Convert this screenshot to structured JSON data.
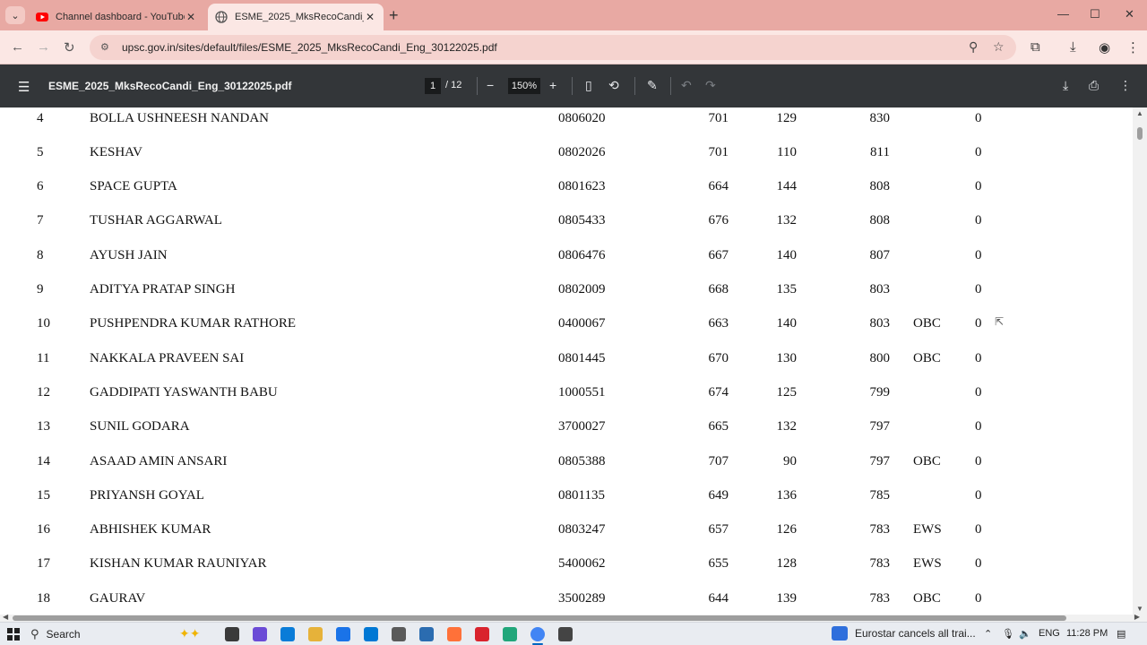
{
  "browser": {
    "tabs": [
      {
        "title": "Channel dashboard - YouTube Studio",
        "active": false,
        "favicon": "youtube-icon",
        "favicon_color": "#ff0000"
      },
      {
        "title": "ESME_2025_MksRecoCandi_Eng_30122025.pdf",
        "active": true,
        "favicon": "globe-icon"
      }
    ],
    "url": "upsc.gov.in/sites/default/files/ESME_2025_MksRecoCandi_Eng_30122025.pdf",
    "tabbar_color": "#e8a9a3"
  },
  "pdf_viewer": {
    "file_name": "ESME_2025_MksRecoCandi_Eng_30122025.pdf",
    "current_page": "1",
    "total_pages": "/ 12",
    "zoom": "150%",
    "toolbar_color": "#333639"
  },
  "table": {
    "rows": [
      {
        "rank": "4",
        "name": "BOLLA USHNEESH NANDAN",
        "roll": "0806020",
        "written": "701",
        "interview": "129",
        "total": "830",
        "category": "",
        "pwd": "0"
      },
      {
        "rank": "5",
        "name": "KESHAV",
        "roll": "0802026",
        "written": "701",
        "interview": "110",
        "total": "811",
        "category": "",
        "pwd": "0"
      },
      {
        "rank": "6",
        "name": "SPACE GUPTA",
        "roll": "0801623",
        "written": "664",
        "interview": "144",
        "total": "808",
        "category": "",
        "pwd": "0"
      },
      {
        "rank": "7",
        "name": "TUSHAR AGGARWAL",
        "roll": "0805433",
        "written": "676",
        "interview": "132",
        "total": "808",
        "category": "",
        "pwd": "0"
      },
      {
        "rank": "8",
        "name": "AYUSH JAIN",
        "roll": "0806476",
        "written": "667",
        "interview": "140",
        "total": "807",
        "category": "",
        "pwd": "0"
      },
      {
        "rank": "9",
        "name": "ADITYA PRATAP SINGH",
        "roll": "0802009",
        "written": "668",
        "interview": "135",
        "total": "803",
        "category": "",
        "pwd": "0"
      },
      {
        "rank": "10",
        "name": "PUSHPENDRA KUMAR RATHORE",
        "roll": "0400067",
        "written": "663",
        "interview": "140",
        "total": "803",
        "category": "OBC",
        "pwd": "0"
      },
      {
        "rank": "11",
        "name": "NAKKALA PRAVEEN SAI",
        "roll": "0801445",
        "written": "670",
        "interview": "130",
        "total": "800",
        "category": "OBC",
        "pwd": "0"
      },
      {
        "rank": "12",
        "name": "GADDIPATI YASWANTH BABU",
        "roll": "1000551",
        "written": "674",
        "interview": "125",
        "total": "799",
        "category": "",
        "pwd": "0"
      },
      {
        "rank": "13",
        "name": "SUNIL GODARA",
        "roll": "3700027",
        "written": "665",
        "interview": "132",
        "total": "797",
        "category": "",
        "pwd": "0"
      },
      {
        "rank": "14",
        "name": "ASAAD AMIN ANSARI",
        "roll": "0805388",
        "written": "707",
        "interview": "90",
        "total": "797",
        "category": "OBC",
        "pwd": "0"
      },
      {
        "rank": "15",
        "name": "PRIYANSH GOYAL",
        "roll": "0801135",
        "written": "649",
        "interview": "136",
        "total": "785",
        "category": "",
        "pwd": "0"
      },
      {
        "rank": "16",
        "name": "ABHISHEK KUMAR",
        "roll": "0803247",
        "written": "657",
        "interview": "126",
        "total": "783",
        "category": "EWS",
        "pwd": "0"
      },
      {
        "rank": "17",
        "name": "KISHAN KUMAR RAUNIYAR",
        "roll": "5400062",
        "written": "655",
        "interview": "128",
        "total": "783",
        "category": "EWS",
        "pwd": "0"
      },
      {
        "rank": "18",
        "name": "GAURAV",
        "roll": "3500289",
        "written": "644",
        "interview": "139",
        "total": "783",
        "category": "OBC",
        "pwd": "0"
      }
    ]
  },
  "taskbar": {
    "search_label": "Search",
    "news_text": "Eurostar cancels all trai...",
    "language": "ENG",
    "time": "11:28 PM",
    "pinned_apps": [
      "task-view-icon",
      "copilot-icon",
      "edge-icon",
      "file-explorer-icon",
      "outlook-icon",
      "app-icon",
      "app-icon",
      "app-icon",
      "firefox-icon",
      "opera-icon",
      "app-icon",
      "chrome-icon",
      "settings-icon"
    ]
  }
}
